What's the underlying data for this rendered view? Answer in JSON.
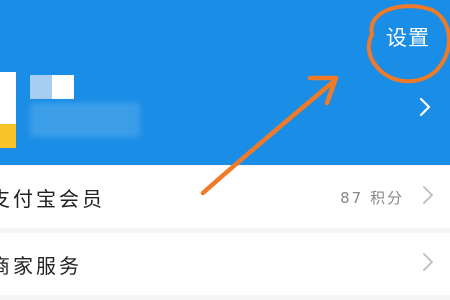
{
  "header": {
    "settings_label": "设置",
    "background_color": "#1a8ee6"
  },
  "profile": {
    "avatar_icon": "user-avatar",
    "username_obscured": true
  },
  "menu": [
    {
      "label": "支付宝会员",
      "value": "87 积分",
      "icon": "chevron-right-icon"
    },
    {
      "label": "商家服务",
      "value": "",
      "icon": "chevron-right-icon"
    }
  ],
  "annotation": {
    "color": "#f07a28",
    "shapes": [
      "circle around settings",
      "arrow pointing to settings"
    ]
  }
}
